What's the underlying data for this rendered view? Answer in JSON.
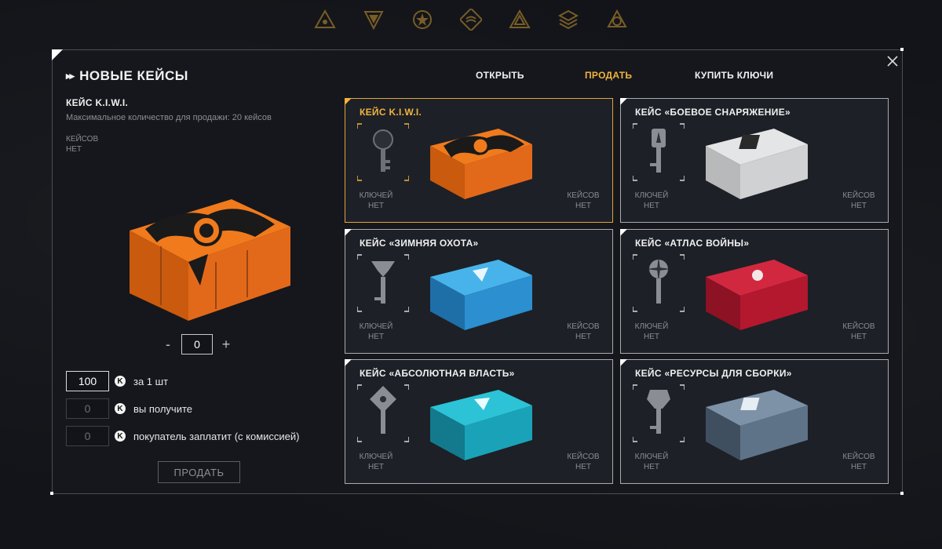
{
  "header_icons": [
    "emblem-triangle-icon",
    "emblem-shield-icon",
    "emblem-star-icon",
    "emblem-wave-icon",
    "emblem-pyramid-icon",
    "emblem-stack-icon",
    "emblem-atom-icon"
  ],
  "modal": {
    "title": "НОВЫЕ КЕЙСЫ",
    "tabs": [
      "ОТКРЫТЬ",
      "ПРОДАТЬ",
      "КУПИТЬ КЛЮЧИ"
    ],
    "active_tab": "ПРОДАТЬ"
  },
  "selected": {
    "name": "КЕЙС K.I.W.I.",
    "max_text": "Максимальное количество для продажи: 20 кейсов",
    "cases_label": "КЕЙСОВ",
    "cases_value": "НЕТ",
    "quantity": "0",
    "minus": "-",
    "plus": "+"
  },
  "price": {
    "coin": "K",
    "per_unit_value": "100",
    "per_unit_label": "за 1 шт",
    "receive_value": "0",
    "receive_label": "вы получите",
    "buyer_value": "0",
    "buyer_label": "покупатель заплатит (с комиссией)",
    "sell_button": "ПРОДАТЬ"
  },
  "cards": [
    {
      "name": "КЕЙС K.I.W.I.",
      "keys_label": "КЛЮЧЕЙ",
      "keys_value": "НЕТ",
      "cases_label": "КЕЙСОВ",
      "cases_value": "НЕТ",
      "selected": true,
      "color": "#e06a18"
    },
    {
      "name": "КЕЙС «БОЕВОЕ СНАРЯЖЕНИЕ»",
      "keys_label": "КЛЮЧЕЙ",
      "keys_value": "НЕТ",
      "cases_label": "КЕЙСОВ",
      "cases_value": "НЕТ",
      "selected": false,
      "color": "#cfd1d3"
    },
    {
      "name": "КЕЙС «ЗИМНЯЯ ОХОТА»",
      "keys_label": "КЛЮЧЕЙ",
      "keys_value": "НЕТ",
      "cases_label": "КЕЙСОВ",
      "cases_value": "НЕТ",
      "selected": false,
      "color": "#2b8fd0"
    },
    {
      "name": "КЕЙС «АТЛАС ВОЙНЫ»",
      "keys_label": "КЛЮЧЕЙ",
      "keys_value": "НЕТ",
      "cases_label": "КЕЙСОВ",
      "cases_value": "НЕТ",
      "selected": false,
      "color": "#b3182e"
    },
    {
      "name": "КЕЙС «АБСОЛЮТНАЯ ВЛАСТЬ»",
      "keys_label": "КЛЮЧЕЙ",
      "keys_value": "НЕТ",
      "cases_label": "КЕЙСОВ",
      "cases_value": "НЕТ",
      "selected": false,
      "color": "#1aa3b8"
    },
    {
      "name": "КЕЙС «РЕСУРСЫ ДЛЯ СБОРКИ»",
      "keys_label": "КЛЮЧЕЙ",
      "keys_value": "НЕТ",
      "cases_label": "КЕЙСОВ",
      "cases_value": "НЕТ",
      "selected": false,
      "color": "#5f7388"
    }
  ],
  "colors": {
    "accent": "#f2b33d",
    "border": "#a9abb0",
    "panel": "#1d2027"
  }
}
